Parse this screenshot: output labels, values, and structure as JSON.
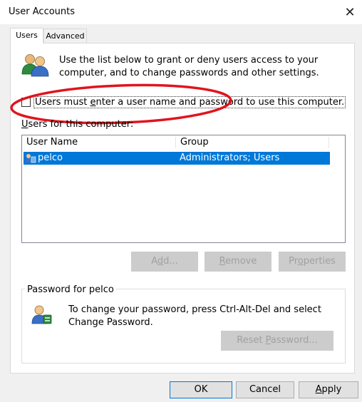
{
  "window": {
    "title": "User Accounts",
    "close_glyph": "✕"
  },
  "tabs": [
    {
      "label": "Users",
      "active": true
    },
    {
      "label": "Advanced",
      "active": false
    }
  ],
  "intro": {
    "icon": "users-icon",
    "line1": "Use the list below to grant or deny users access to your",
    "line2": "computer, and to change passwords and other settings."
  },
  "require_login": {
    "label_pre": "Users must ",
    "label_accel": "e",
    "label_post": "nter a user name and password to use this computer.",
    "checked": false
  },
  "users_list": {
    "label_accel": "U",
    "label_rest": "sers for this computer:",
    "columns": [
      "User Name",
      "Group"
    ],
    "rows": [
      {
        "user": "pelco",
        "group": "Administrators; Users",
        "selected": true
      }
    ]
  },
  "list_buttons": {
    "add_pre": "A",
    "add_accel": "d",
    "add_post": "d...",
    "remove_accel": "R",
    "remove_rest": "emove",
    "properties_pre": "Pr",
    "properties_accel": "o",
    "properties_post": "perties"
  },
  "password_group": {
    "title": "Password for pelco",
    "icon": "user-password-icon",
    "line1": "To change your password, press Ctrl-Alt-Del and select",
    "line2": "Change Password.",
    "reset_pre": "Reset ",
    "reset_accel": "P",
    "reset_post": "assword..."
  },
  "footer_buttons": {
    "ok": "OK",
    "cancel": "Cancel",
    "apply_accel": "A",
    "apply_rest": "pply"
  },
  "colors": {
    "selection": "#0078d7",
    "annotation": "#e0141e",
    "disabled_text": "#a0a0a0"
  }
}
